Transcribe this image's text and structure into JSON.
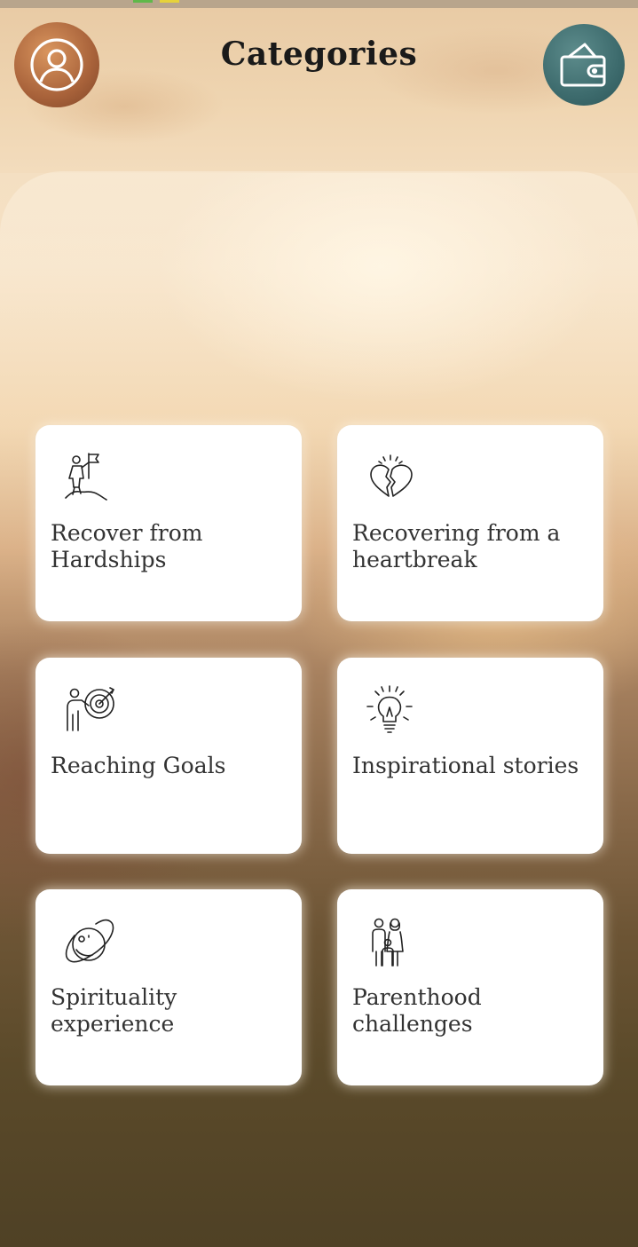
{
  "header": {
    "title": "Categories",
    "profile_icon": "user-circle-icon",
    "wallet_icon": "wallet-icon"
  },
  "categories": [
    {
      "label": "Recover from Hardships",
      "icon": "summit-flag-icon"
    },
    {
      "label": "Recovering from a heartbreak",
      "icon": "broken-heart-icon"
    },
    {
      "label": "Reaching Goals",
      "icon": "target-goal-icon"
    },
    {
      "label": "Inspirational stories",
      "icon": "lightbulb-icon"
    },
    {
      "label": "Spirituality experience",
      "icon": "planet-icon"
    },
    {
      "label": "Parenthood challenges",
      "icon": "family-icon"
    }
  ],
  "colors": {
    "profile_button": "#a8623a",
    "wallet_button": "#3d6b6d",
    "card_background": "#ffffff",
    "title_text": "#1a1a1a",
    "label_text": "#333333"
  }
}
